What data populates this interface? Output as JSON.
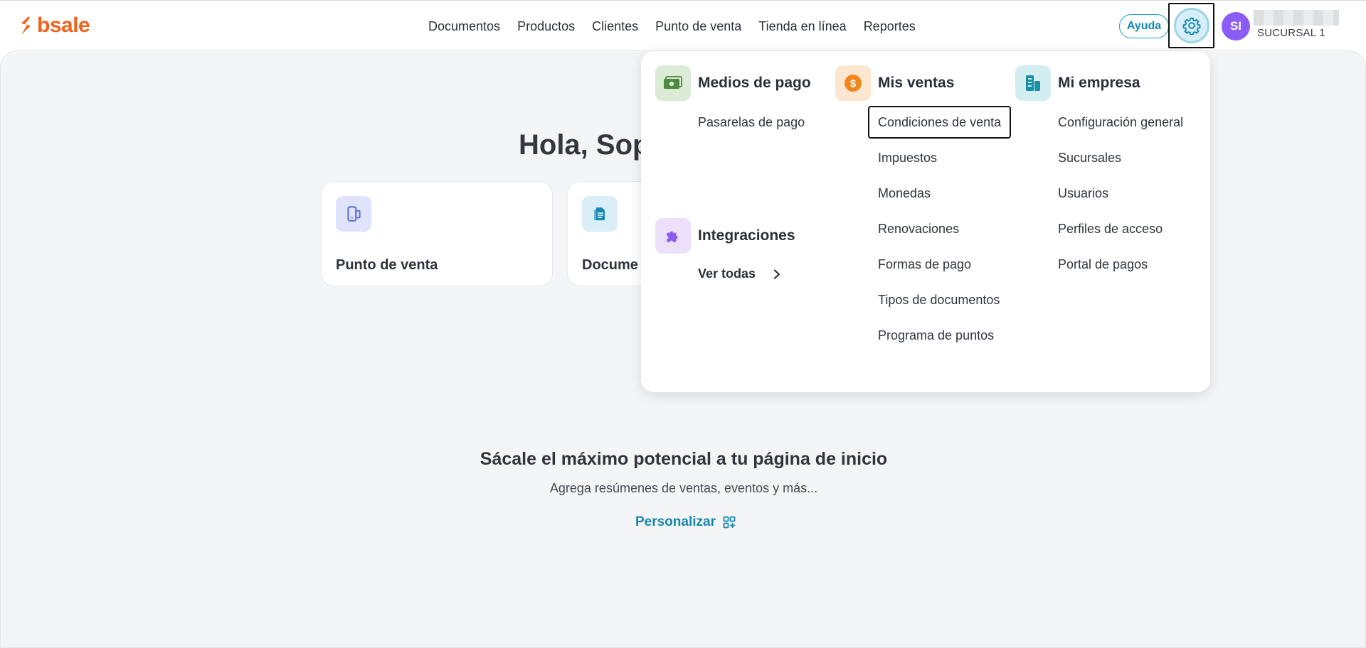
{
  "header": {
    "logo_text": "bsale",
    "nav": [
      "Documentos",
      "Productos",
      "Clientes",
      "Punto de venta",
      "Tienda en línea",
      "Reportes"
    ],
    "help_label": "Ayuda",
    "avatar_initials": "SI",
    "branch": "SUCURSAL 1"
  },
  "main": {
    "greeting": "Hola, Sop",
    "cards": [
      {
        "label": "Punto de venta",
        "icon": "pos-device-icon"
      },
      {
        "label": "Docume",
        "icon": "document-icon"
      }
    ],
    "promo": {
      "title": "Sácale el máximo potencial a tu página de inicio",
      "subtitle": "Agrega resúmenes de ventas, eventos y más...",
      "link": "Personalizar"
    }
  },
  "settings_menu": {
    "payment": {
      "title": "Medios de pago",
      "icon": "cash-icon",
      "links": [
        "Pasarelas de pago"
      ]
    },
    "integrations": {
      "title": "Integraciones",
      "icon": "puzzle-icon",
      "see_all": "Ver todas"
    },
    "sales": {
      "title": "Mis ventas",
      "icon": "dollar-coin-icon",
      "links": [
        "Condiciones de venta",
        "Impuestos",
        "Monedas",
        "Renovaciones",
        "Formas de pago",
        "Tipos de documentos",
        "Programa de puntos"
      ]
    },
    "company": {
      "title": "Mi empresa",
      "icon": "buildings-icon",
      "links": [
        "Configuración general",
        "Sucursales",
        "Usuarios",
        "Perfiles de acceso",
        "Portal de pagos"
      ]
    }
  },
  "colors": {
    "brand": "#f2621f",
    "accent": "#1586ad",
    "avatar": "#8b5cf6"
  }
}
